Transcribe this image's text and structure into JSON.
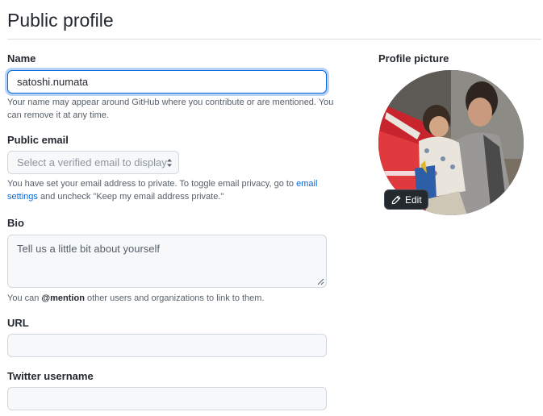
{
  "page": {
    "title": "Public profile"
  },
  "name_field": {
    "label": "Name",
    "value": "satoshi.numata",
    "help": "Your name may appear around GitHub where you contribute or are mentioned. You can remove it at any time."
  },
  "email_field": {
    "label": "Public email",
    "placeholder": "Select a verified email to display",
    "help_before": "You have set your email address to private. To toggle email privacy, go to",
    "help_link": "email settings",
    "help_after": "and uncheck \"Keep my email address private.\""
  },
  "bio_field": {
    "label": "Bio",
    "placeholder": "Tell us a little bit about yourself",
    "help_before": "You can",
    "help_mention": "@mention",
    "help_after": "other users and organizations to link to them."
  },
  "url_field": {
    "label": "URL",
    "value": ""
  },
  "twitter_field": {
    "label": "Twitter username",
    "value": ""
  },
  "profile_picture": {
    "label": "Profile picture",
    "edit_label": "Edit"
  },
  "colors": {
    "accent": "#0969da",
    "text": "#24292f",
    "muted": "#57606a",
    "border": "#d0d7de"
  }
}
